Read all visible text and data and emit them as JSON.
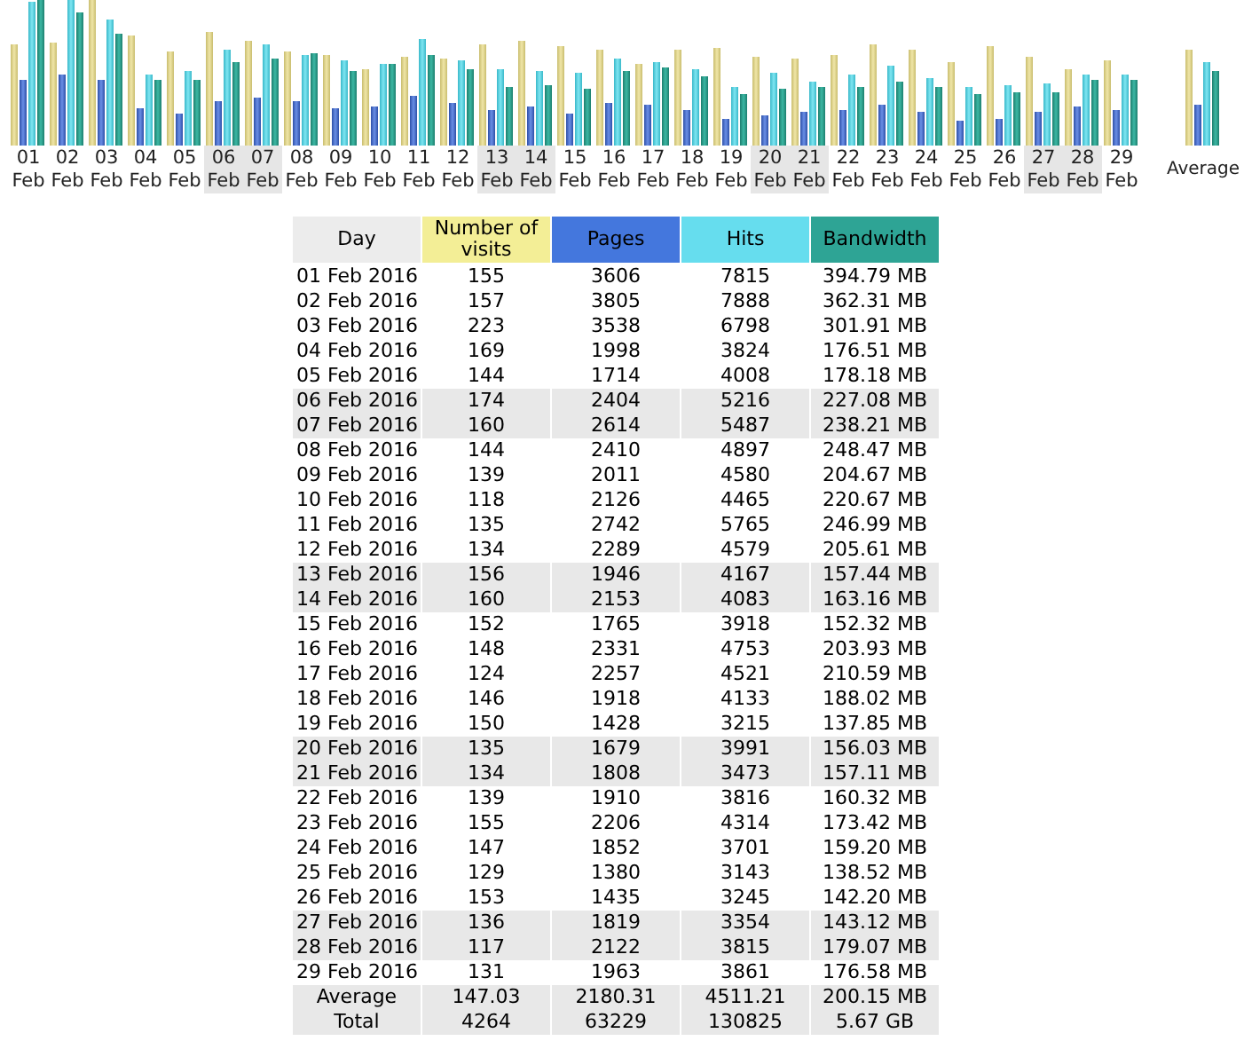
{
  "chart": {
    "labels": [
      {
        "day": "01",
        "month": "Feb",
        "weekend": false
      },
      {
        "day": "02",
        "month": "Feb",
        "weekend": false
      },
      {
        "day": "03",
        "month": "Feb",
        "weekend": false
      },
      {
        "day": "04",
        "month": "Feb",
        "weekend": false
      },
      {
        "day": "05",
        "month": "Feb",
        "weekend": false
      },
      {
        "day": "06",
        "month": "Feb",
        "weekend": true
      },
      {
        "day": "07",
        "month": "Feb",
        "weekend": true
      },
      {
        "day": "08",
        "month": "Feb",
        "weekend": false
      },
      {
        "day": "09",
        "month": "Feb",
        "weekend": false
      },
      {
        "day": "10",
        "month": "Feb",
        "weekend": false
      },
      {
        "day": "11",
        "month": "Feb",
        "weekend": false
      },
      {
        "day": "12",
        "month": "Feb",
        "weekend": false
      },
      {
        "day": "13",
        "month": "Feb",
        "weekend": true
      },
      {
        "day": "14",
        "month": "Feb",
        "weekend": true
      },
      {
        "day": "15",
        "month": "Feb",
        "weekend": false
      },
      {
        "day": "16",
        "month": "Feb",
        "weekend": false
      },
      {
        "day": "17",
        "month": "Feb",
        "weekend": false
      },
      {
        "day": "18",
        "month": "Feb",
        "weekend": false
      },
      {
        "day": "19",
        "month": "Feb",
        "weekend": false
      },
      {
        "day": "20",
        "month": "Feb",
        "weekend": true
      },
      {
        "day": "21",
        "month": "Feb",
        "weekend": true
      },
      {
        "day": "22",
        "month": "Feb",
        "weekend": false
      },
      {
        "day": "23",
        "month": "Feb",
        "weekend": false
      },
      {
        "day": "24",
        "month": "Feb",
        "weekend": false
      },
      {
        "day": "25",
        "month": "Feb",
        "weekend": false
      },
      {
        "day": "26",
        "month": "Feb",
        "weekend": false
      },
      {
        "day": "27",
        "month": "Feb",
        "weekend": true
      },
      {
        "day": "28",
        "month": "Feb",
        "weekend": true
      },
      {
        "day": "29",
        "month": "Feb",
        "weekend": false
      }
    ],
    "average_label": "Average"
  },
  "table": {
    "columns": [
      {
        "label": "Day",
        "color": "#ececec"
      },
      {
        "label": "Number of visits",
        "color": "#f3ee96"
      },
      {
        "label": "Pages",
        "color": "#4477dd"
      },
      {
        "label": "Hits",
        "color": "#66ddee"
      },
      {
        "label": "Bandwidth",
        "color": "#2ea495"
      }
    ],
    "rows": [
      {
        "day": "01 Feb 2016",
        "visits": "155",
        "pages": "3606",
        "hits": "7815",
        "bandwidth": "394.79 MB",
        "weekend": false
      },
      {
        "day": "02 Feb 2016",
        "visits": "157",
        "pages": "3805",
        "hits": "7888",
        "bandwidth": "362.31 MB",
        "weekend": false
      },
      {
        "day": "03 Feb 2016",
        "visits": "223",
        "pages": "3538",
        "hits": "6798",
        "bandwidth": "301.91 MB",
        "weekend": false
      },
      {
        "day": "04 Feb 2016",
        "visits": "169",
        "pages": "1998",
        "hits": "3824",
        "bandwidth": "176.51 MB",
        "weekend": false
      },
      {
        "day": "05 Feb 2016",
        "visits": "144",
        "pages": "1714",
        "hits": "4008",
        "bandwidth": "178.18 MB",
        "weekend": false
      },
      {
        "day": "06 Feb 2016",
        "visits": "174",
        "pages": "2404",
        "hits": "5216",
        "bandwidth": "227.08 MB",
        "weekend": true
      },
      {
        "day": "07 Feb 2016",
        "visits": "160",
        "pages": "2614",
        "hits": "5487",
        "bandwidth": "238.21 MB",
        "weekend": true
      },
      {
        "day": "08 Feb 2016",
        "visits": "144",
        "pages": "2410",
        "hits": "4897",
        "bandwidth": "248.47 MB",
        "weekend": false
      },
      {
        "day": "09 Feb 2016",
        "visits": "139",
        "pages": "2011",
        "hits": "4580",
        "bandwidth": "204.67 MB",
        "weekend": false
      },
      {
        "day": "10 Feb 2016",
        "visits": "118",
        "pages": "2126",
        "hits": "4465",
        "bandwidth": "220.67 MB",
        "weekend": false
      },
      {
        "day": "11 Feb 2016",
        "visits": "135",
        "pages": "2742",
        "hits": "5765",
        "bandwidth": "246.99 MB",
        "weekend": false
      },
      {
        "day": "12 Feb 2016",
        "visits": "134",
        "pages": "2289",
        "hits": "4579",
        "bandwidth": "205.61 MB",
        "weekend": false
      },
      {
        "day": "13 Feb 2016",
        "visits": "156",
        "pages": "1946",
        "hits": "4167",
        "bandwidth": "157.44 MB",
        "weekend": true
      },
      {
        "day": "14 Feb 2016",
        "visits": "160",
        "pages": "2153",
        "hits": "4083",
        "bandwidth": "163.16 MB",
        "weekend": true
      },
      {
        "day": "15 Feb 2016",
        "visits": "152",
        "pages": "1765",
        "hits": "3918",
        "bandwidth": "152.32 MB",
        "weekend": false
      },
      {
        "day": "16 Feb 2016",
        "visits": "148",
        "pages": "2331",
        "hits": "4753",
        "bandwidth": "203.93 MB",
        "weekend": false
      },
      {
        "day": "17 Feb 2016",
        "visits": "124",
        "pages": "2257",
        "hits": "4521",
        "bandwidth": "210.59 MB",
        "weekend": false
      },
      {
        "day": "18 Feb 2016",
        "visits": "146",
        "pages": "1918",
        "hits": "4133",
        "bandwidth": "188.02 MB",
        "weekend": false
      },
      {
        "day": "19 Feb 2016",
        "visits": "150",
        "pages": "1428",
        "hits": "3215",
        "bandwidth": "137.85 MB",
        "weekend": false
      },
      {
        "day": "20 Feb 2016",
        "visits": "135",
        "pages": "1679",
        "hits": "3991",
        "bandwidth": "156.03 MB",
        "weekend": true
      },
      {
        "day": "21 Feb 2016",
        "visits": "134",
        "pages": "1808",
        "hits": "3473",
        "bandwidth": "157.11 MB",
        "weekend": true
      },
      {
        "day": "22 Feb 2016",
        "visits": "139",
        "pages": "1910",
        "hits": "3816",
        "bandwidth": "160.32 MB",
        "weekend": false
      },
      {
        "day": "23 Feb 2016",
        "visits": "155",
        "pages": "2206",
        "hits": "4314",
        "bandwidth": "173.42 MB",
        "weekend": false
      },
      {
        "day": "24 Feb 2016",
        "visits": "147",
        "pages": "1852",
        "hits": "3701",
        "bandwidth": "159.20 MB",
        "weekend": false
      },
      {
        "day": "25 Feb 2016",
        "visits": "129",
        "pages": "1380",
        "hits": "3143",
        "bandwidth": "138.52 MB",
        "weekend": false
      },
      {
        "day": "26 Feb 2016",
        "visits": "153",
        "pages": "1435",
        "hits": "3245",
        "bandwidth": "142.20 MB",
        "weekend": false
      },
      {
        "day": "27 Feb 2016",
        "visits": "136",
        "pages": "1819",
        "hits": "3354",
        "bandwidth": "143.12 MB",
        "weekend": true
      },
      {
        "day": "28 Feb 2016",
        "visits": "117",
        "pages": "2122",
        "hits": "3815",
        "bandwidth": "179.07 MB",
        "weekend": true
      },
      {
        "day": "29 Feb 2016",
        "visits": "131",
        "pages": "1963",
        "hits": "3861",
        "bandwidth": "176.58 MB",
        "weekend": false
      }
    ],
    "summary": [
      {
        "day": "Average",
        "visits": "147.03",
        "pages": "2180.31",
        "hits": "4511.21",
        "bandwidth": "200.15 MB"
      },
      {
        "day": "Total",
        "visits": "4264",
        "pages": "63229",
        "hits": "130825",
        "bandwidth": "5.67 GB"
      }
    ]
  }
}
